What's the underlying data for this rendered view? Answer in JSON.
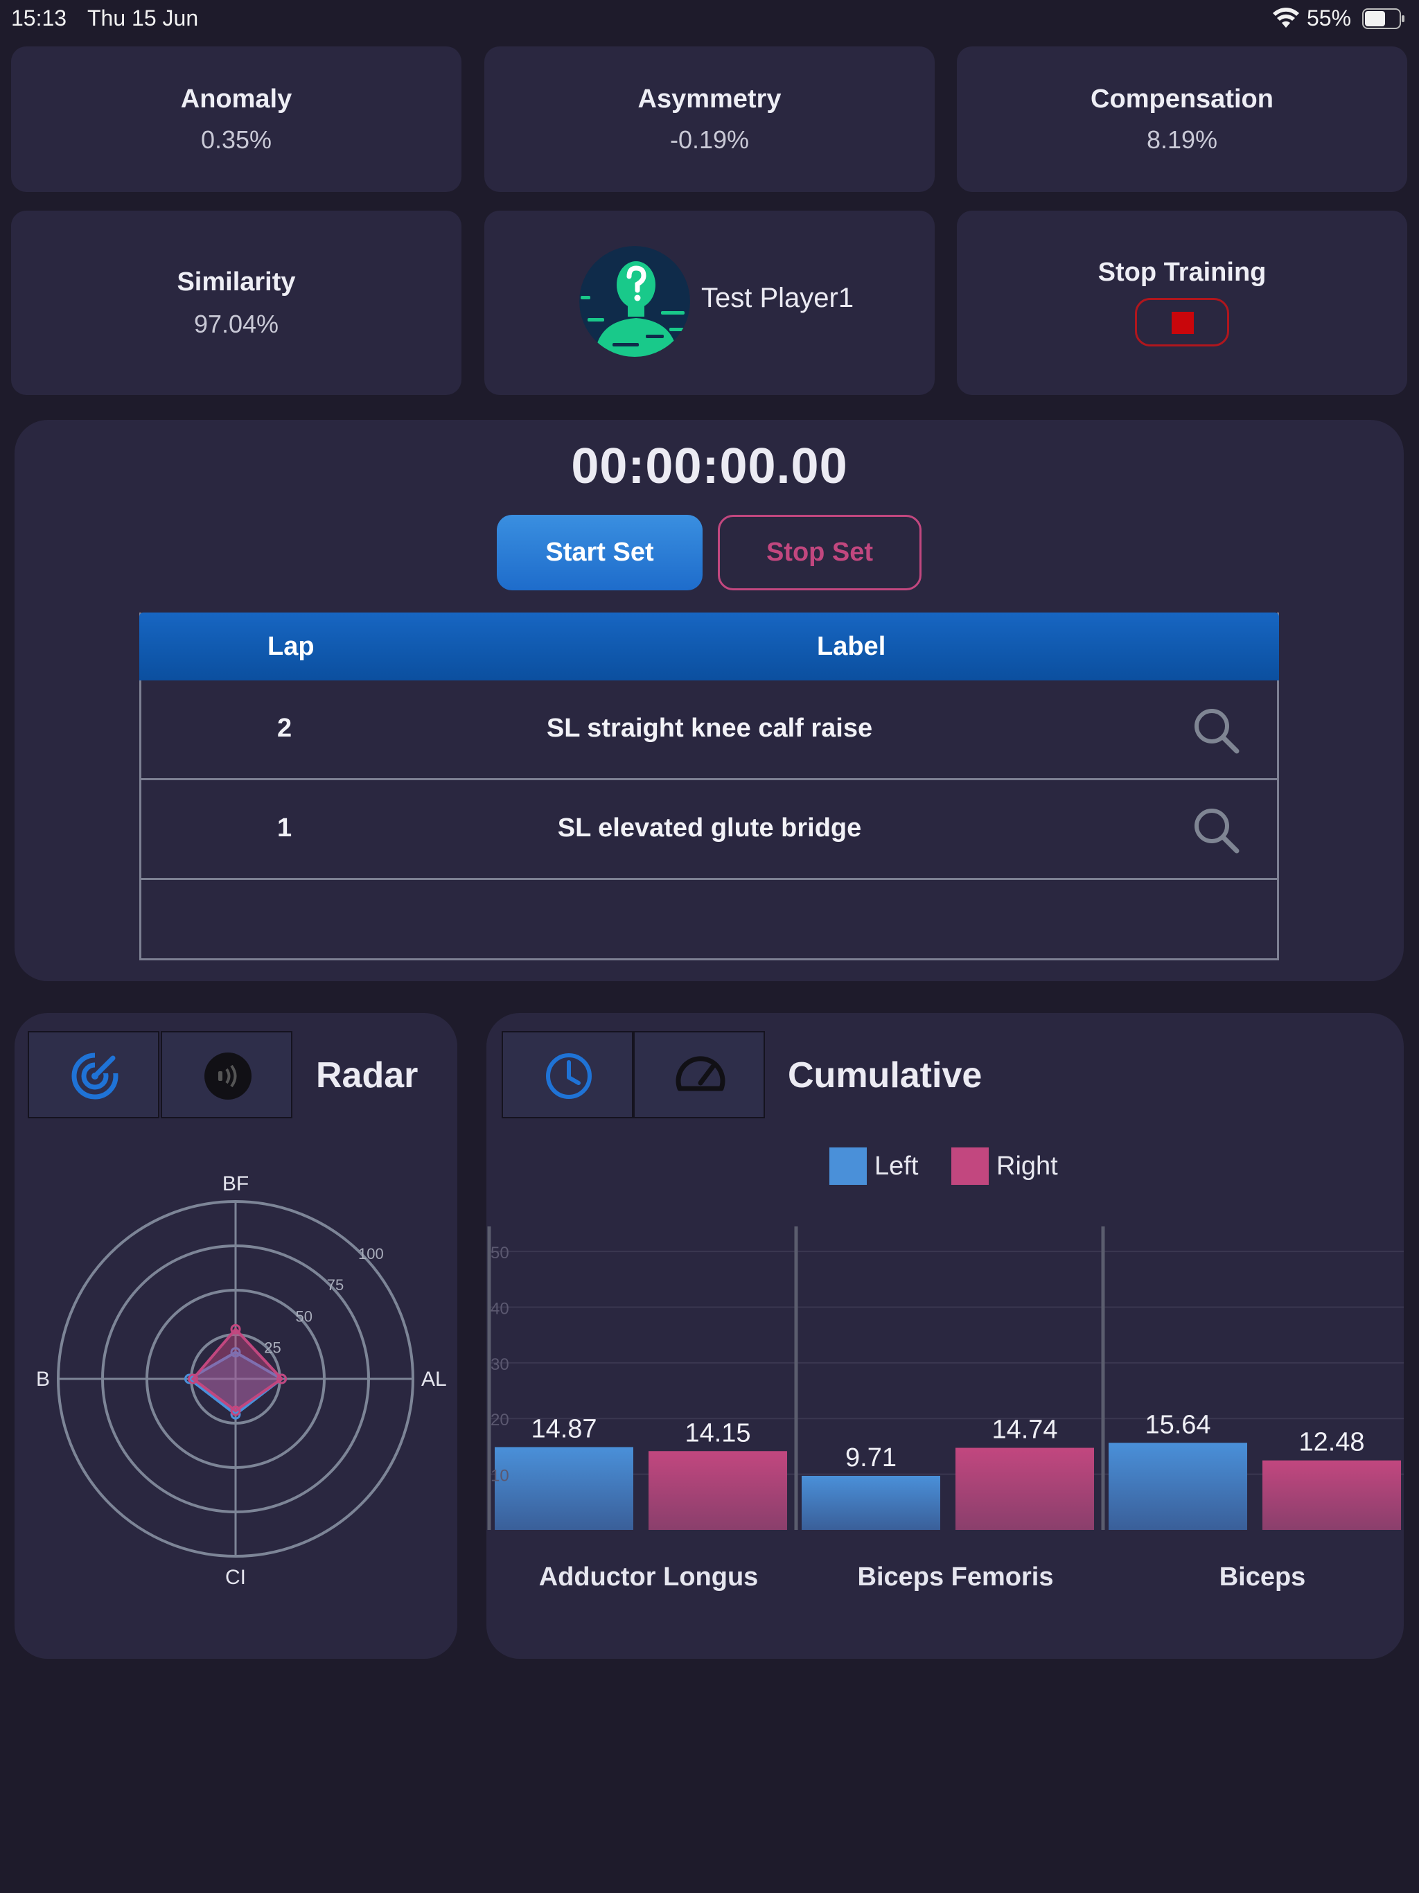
{
  "status_bar": {
    "time": "15:13",
    "date": "Thu 15 Jun",
    "battery": "55%"
  },
  "metrics": [
    {
      "title": "Anomaly",
      "value": "0.35%"
    },
    {
      "title": "Asymmetry",
      "value": "-0.19%"
    },
    {
      "title": "Compensation",
      "value": "8.19%"
    },
    {
      "title": "Similarity",
      "value": "97.04%"
    }
  ],
  "player": {
    "name": "Test Player1"
  },
  "stop_training": {
    "label": "Stop Training"
  },
  "timer": {
    "value": "00:00:00.00"
  },
  "buttons": {
    "start_set": "Start Set",
    "stop_set": "Stop Set"
  },
  "lap_table": {
    "headers": {
      "lap": "Lap",
      "label": "Label"
    },
    "rows": [
      {
        "lap": "2",
        "label": "SL straight knee calf raise"
      },
      {
        "lap": "1",
        "label": "SL elevated glute bridge"
      }
    ]
  },
  "radar_panel": {
    "title": "Radar"
  },
  "cumulative_panel": {
    "title": "Cumulative"
  },
  "colors": {
    "left": "#4a90d9",
    "right": "#c2477f",
    "accent_blue": "#1f73d6",
    "stop_red": "#c9060b"
  },
  "chart_data": [
    {
      "type": "radar",
      "axes": [
        "BF",
        "AL",
        "CI",
        "B"
      ],
      "ticks": [
        25,
        50,
        75,
        100
      ],
      "range": [
        0,
        100
      ],
      "series": [
        {
          "color": "#4a90d9",
          "values": [
            15,
            26,
            20,
            26
          ]
        },
        {
          "color": "#c2477f",
          "values": [
            28,
            26,
            18,
            24
          ]
        }
      ]
    },
    {
      "type": "bar",
      "categories": [
        "Adductor Longus",
        "Biceps Femoris",
        "Biceps"
      ],
      "series": [
        {
          "name": "Left",
          "color": "#4a90d9",
          "values": [
            14.87,
            9.71,
            15.64
          ]
        },
        {
          "name": "Right",
          "color": "#c2477f",
          "values": [
            14.15,
            14.74,
            12.48
          ]
        }
      ],
      "y_ticks": [
        10,
        20,
        30,
        40,
        50
      ],
      "ylim": [
        0,
        52
      ],
      "legend": "top-center"
    }
  ]
}
